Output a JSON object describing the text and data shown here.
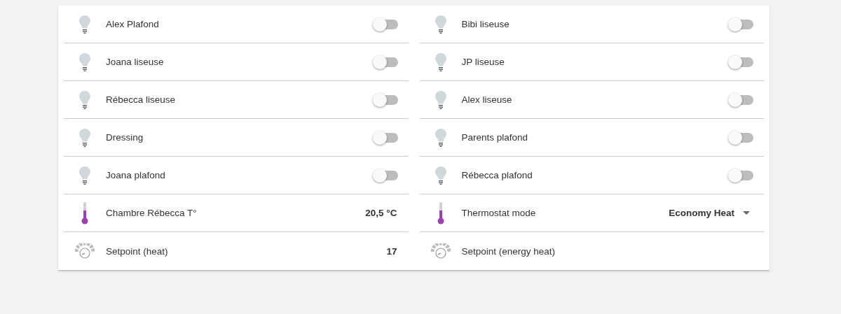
{
  "columns": [
    {
      "rows": [
        {
          "kind": "light",
          "name": "Alex Plafond",
          "on": false
        },
        {
          "kind": "light",
          "name": "Joana liseuse",
          "on": false
        },
        {
          "kind": "light",
          "name": "Rébecca liseuse",
          "on": false
        },
        {
          "kind": "light",
          "name": "Dressing",
          "on": false
        },
        {
          "kind": "light",
          "name": "Joana plafond",
          "on": false
        },
        {
          "kind": "temperature",
          "name": "Chambre Rébecca T°",
          "value": "20,5 °C"
        },
        {
          "kind": "setpoint",
          "name": "Setpoint (heat)",
          "value": "17"
        }
      ]
    },
    {
      "rows": [
        {
          "kind": "light",
          "name": "Bibi liseuse",
          "on": false
        },
        {
          "kind": "light",
          "name": "JP liseuse",
          "on": false
        },
        {
          "kind": "light",
          "name": "Alex liseuse",
          "on": false
        },
        {
          "kind": "light",
          "name": "Parents plafond",
          "on": false
        },
        {
          "kind": "light",
          "name": "Rébecca plafond",
          "on": false
        },
        {
          "kind": "mode",
          "name": "Thermostat mode",
          "value": "Economy Heat"
        },
        {
          "kind": "setpoint",
          "name": "Setpoint (energy heat)"
        }
      ]
    }
  ]
}
